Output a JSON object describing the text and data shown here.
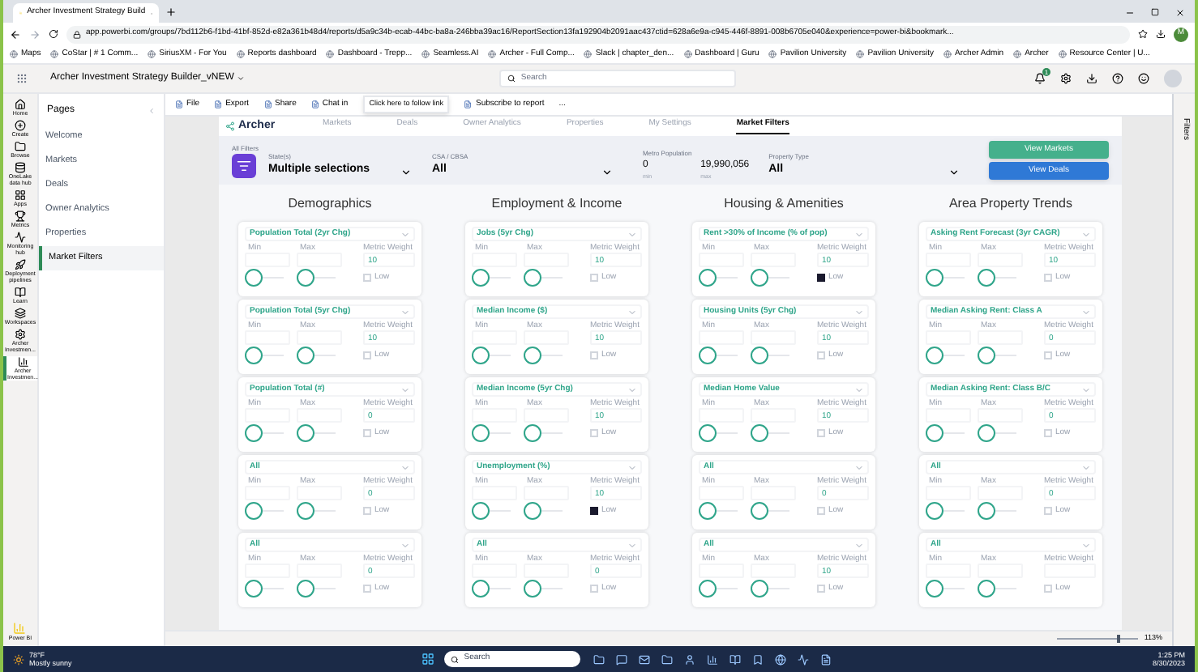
{
  "browser": {
    "tab_title": "Archer Investment Strategy Build",
    "url": "app.powerbi.com/groups/7bd112b6-f1bd-41bf-852d-e82a361b48d4/reports/d5a9c34b-ecab-44bc-ba8a-246bba39ac16/ReportSection13fa192904b2091aac437ctid=628a6e9a-c945-446f-8891-008b6705e040&experience=power-bi&bookmark...",
    "profile": "M",
    "bookmarks": [
      "Maps",
      "CoStar | # 1 Comm...",
      "SiriusXM - For You",
      "Reports dashboard",
      "Dashboard - Trepp...",
      "Seamless.AI",
      "Archer - Full Comp...",
      "Slack | chapter_den...",
      "Dashboard | Guru",
      "Pavilion University",
      "Pavilion University",
      "Archer Admin",
      "Archer",
      "Resource Center | U..."
    ]
  },
  "header": {
    "title": "Archer Investment Strategy Builder_vNEW",
    "search_placeholder": "Search",
    "notifications": "1"
  },
  "nav": [
    {
      "label": "Home",
      "selected": false
    },
    {
      "label": "Create",
      "selected": false
    },
    {
      "label": "Browse",
      "selected": false
    },
    {
      "label": "OneLake data hub",
      "selected": false
    },
    {
      "label": "Apps",
      "selected": false
    },
    {
      "label": "Metrics",
      "selected": false
    },
    {
      "label": "Monitoring hub",
      "selected": false
    },
    {
      "label": "Deployment pipelines",
      "selected": false
    },
    {
      "label": "Learn",
      "selected": false
    },
    {
      "label": "Workspaces",
      "selected": false
    },
    {
      "label": "Archer Investmen...",
      "selected": false
    },
    {
      "label": "Archer Investmen...",
      "selected": true
    }
  ],
  "nav_footer": "Power BI",
  "pages": {
    "title": "Pages",
    "items": [
      {
        "label": "Welcome",
        "selected": false
      },
      {
        "label": "Markets",
        "selected": false
      },
      {
        "label": "Deals",
        "selected": false
      },
      {
        "label": "Owner Analytics",
        "selected": false
      },
      {
        "label": "Properties",
        "selected": false
      },
      {
        "label": "Market Filters",
        "selected": true
      }
    ]
  },
  "toolbar": [
    "File",
    "Export",
    "Share",
    "Chat in",
    "Subscribe to report",
    "..."
  ],
  "tooltip": "Click here to follow link",
  "report": {
    "logo": "Archer",
    "tabs": [
      {
        "label": "Markets",
        "selected": false
      },
      {
        "label": "Deals",
        "selected": false
      },
      {
        "label": "Owner Analytics",
        "selected": false
      },
      {
        "label": "Properties",
        "selected": false
      },
      {
        "label": "My Settings",
        "selected": false
      },
      {
        "label": "Market Filters",
        "selected": true
      }
    ],
    "filters_label": "All Filters",
    "states": {
      "label": "State(s)",
      "value": "Multiple selections"
    },
    "csa": {
      "label": "CSA / CBSA",
      "value": "All"
    },
    "metro": {
      "label": "Metro Population",
      "min": "0",
      "min_label": "min",
      "max": "19,990,056",
      "max_label": "max"
    },
    "property_type": {
      "label": "Property Type",
      "value": "All"
    },
    "buttons": [
      "View Markets",
      "View Deals"
    ],
    "columns": [
      {
        "heading": "Demographics",
        "cards": [
          {
            "title": "Population Total (2yr Chg)",
            "min_label": "Min",
            "max_label": "Max",
            "weight_label": "Metric Weight",
            "weight": "10",
            "low_label": "Low",
            "low_checked": false,
            "sliders": [
              {
                "level": 0
              },
              {
                "level": 0
              }
            ]
          },
          {
            "title": "Population Total (5yr Chg)",
            "min_label": "Min",
            "max_label": "Max",
            "weight_label": "Metric Weight",
            "weight": "10",
            "low_label": "Low",
            "low_checked": false,
            "sliders": [
              {
                "level": 0
              },
              {
                "level": 0
              }
            ]
          },
          {
            "title": "Population Total (#)",
            "min_label": "Min",
            "max_label": "Max",
            "weight_label": "Metric Weight",
            "weight": "0",
            "low_label": "Low",
            "low_checked": false,
            "sliders": [
              {
                "level": 0
              },
              {
                "level": 0
              }
            ]
          },
          {
            "title": "All",
            "min_label": "Min",
            "max_label": "Max",
            "weight_label": "Metric Weight",
            "weight": "0",
            "low_label": "Low",
            "low_checked": false,
            "sliders": [
              {
                "level": 0
              },
              {
                "level": 0
              }
            ]
          },
          {
            "title": "All",
            "min_label": "Min",
            "max_label": "Max",
            "weight_label": "Metric Weight",
            "weight": "0",
            "low_label": "Low",
            "low_checked": false,
            "sliders": [
              {
                "level": 0
              },
              {
                "level": 0
              }
            ]
          }
        ]
      },
      {
        "heading": "Employment & Income",
        "cards": [
          {
            "title": "Jobs (5yr Chg)",
            "min_label": "Min",
            "max_label": "Max",
            "weight_label": "Metric Weight",
            "weight": "10",
            "low_label": "Low",
            "low_checked": false,
            "sliders": [
              {
                "level": 0
              },
              {
                "level": 0
              }
            ]
          },
          {
            "title": "Median Income ($)",
            "min_label": "Min",
            "max_label": "Max",
            "weight_label": "Metric Weight",
            "weight": "10",
            "low_label": "Low",
            "low_checked": false,
            "sliders": [
              {
                "level": 0
              },
              {
                "level": 0
              }
            ]
          },
          {
            "title": "Median Income (5yr Chg)",
            "min_label": "Min",
            "max_label": "Max",
            "weight_label": "Metric Weight",
            "weight": "10",
            "low_label": "Low",
            "low_checked": false,
            "sliders": [
              {
                "level": 0
              },
              {
                "level": 0
              }
            ]
          },
          {
            "title": "Unemployment (%)",
            "min_label": "Min",
            "max_label": "Max",
            "weight_label": "Metric Weight",
            "weight": "10",
            "low_label": "Low",
            "low_checked": true,
            "sliders": [
              {
                "level": 0
              },
              {
                "level": 0
              }
            ]
          },
          {
            "title": "All",
            "min_label": "Min",
            "max_label": "Max",
            "weight_label": "Metric Weight",
            "weight": "0",
            "low_label": "Low",
            "low_checked": false,
            "sliders": [
              {
                "level": 0
              },
              {
                "level": 0
              }
            ]
          }
        ]
      },
      {
        "heading": "Housing & Amenities",
        "cards": [
          {
            "title": "Rent >30% of Income (% of pop)",
            "min_label": "Min",
            "max_label": "Max",
            "weight_label": "Metric Weight",
            "weight": "10",
            "low_label": "Low",
            "low_checked": true,
            "sliders": [
              {
                "level": 0
              },
              {
                "level": 0
              }
            ]
          },
          {
            "title": "Housing Units (5yr Chg)",
            "min_label": "Min",
            "max_label": "Max",
            "weight_label": "Metric Weight",
            "weight": "10",
            "low_label": "Low",
            "low_checked": false,
            "sliders": [
              {
                "level": 0
              },
              {
                "level": 0
              }
            ]
          },
          {
            "title": "Median Home Value",
            "min_label": "Min",
            "max_label": "Max",
            "weight_label": "Metric Weight",
            "weight": "10",
            "low_label": "Low",
            "low_checked": false,
            "sliders": [
              {
                "level": 0
              },
              {
                "level": 0
              }
            ]
          },
          {
            "title": "All",
            "min_label": "Min",
            "max_label": "Max",
            "weight_label": "Metric Weight",
            "weight": "0",
            "low_label": "Low",
            "low_checked": false,
            "sliders": [
              {
                "level": 0
              },
              {
                "level": 0
              }
            ]
          },
          {
            "title": "All",
            "min_label": "Min",
            "max_label": "Max",
            "weight_label": "Metric Weight",
            "weight": "10",
            "low_label": "Low",
            "low_checked": false,
            "sliders": [
              {
                "level": 0
              },
              {
                "level": 0
              }
            ]
          }
        ]
      },
      {
        "heading": "Area Property Trends",
        "cards": [
          {
            "title": "Asking Rent Forecast (3yr CAGR)",
            "min_label": "Min",
            "max_label": "Max",
            "weight_label": "Metric Weight",
            "weight": "10",
            "low_label": "Low",
            "low_checked": false,
            "sliders": [
              {
                "level": 0
              },
              {
                "level": 0
              }
            ]
          },
          {
            "title": "Median Asking Rent: Class A",
            "min_label": "Min",
            "max_label": "Max",
            "weight_label": "Metric Weight",
            "weight": "0",
            "low_label": "Low",
            "low_checked": false,
            "sliders": [
              {
                "level": 0
              },
              {
                "level": 0
              }
            ]
          },
          {
            "title": "Median Asking Rent: Class B/C",
            "min_label": "Min",
            "max_label": "Max",
            "weight_label": "Metric Weight",
            "weight": "0",
            "low_label": "Low",
            "low_checked": false,
            "sliders": [
              {
                "level": 0
              },
              {
                "level": 0
              }
            ]
          },
          {
            "title": "All",
            "min_label": "Min",
            "max_label": "Max",
            "weight_label": "Metric Weight",
            "weight": "0",
            "low_label": "Low",
            "low_checked": false,
            "sliders": [
              {
                "level": 0
              },
              {
                "level": 0
              }
            ]
          },
          {
            "title": "All",
            "min_label": "Min",
            "max_label": "Max",
            "weight_label": "Metric Weight",
            "low_label": "Low",
            "low_checked": false,
            "sliders": [
              {
                "level": 0
              },
              {
                "level": 0
              }
            ]
          }
        ]
      }
    ]
  },
  "filters_pane": "Filters",
  "status_bar": {
    "level": 0.78,
    "zoom": "113%"
  },
  "taskbar": {
    "temperature": "78°F",
    "weather": "Mostly sunny",
    "search": "Search",
    "time": "1:25 PM",
    "date": "8/30/2023"
  }
}
